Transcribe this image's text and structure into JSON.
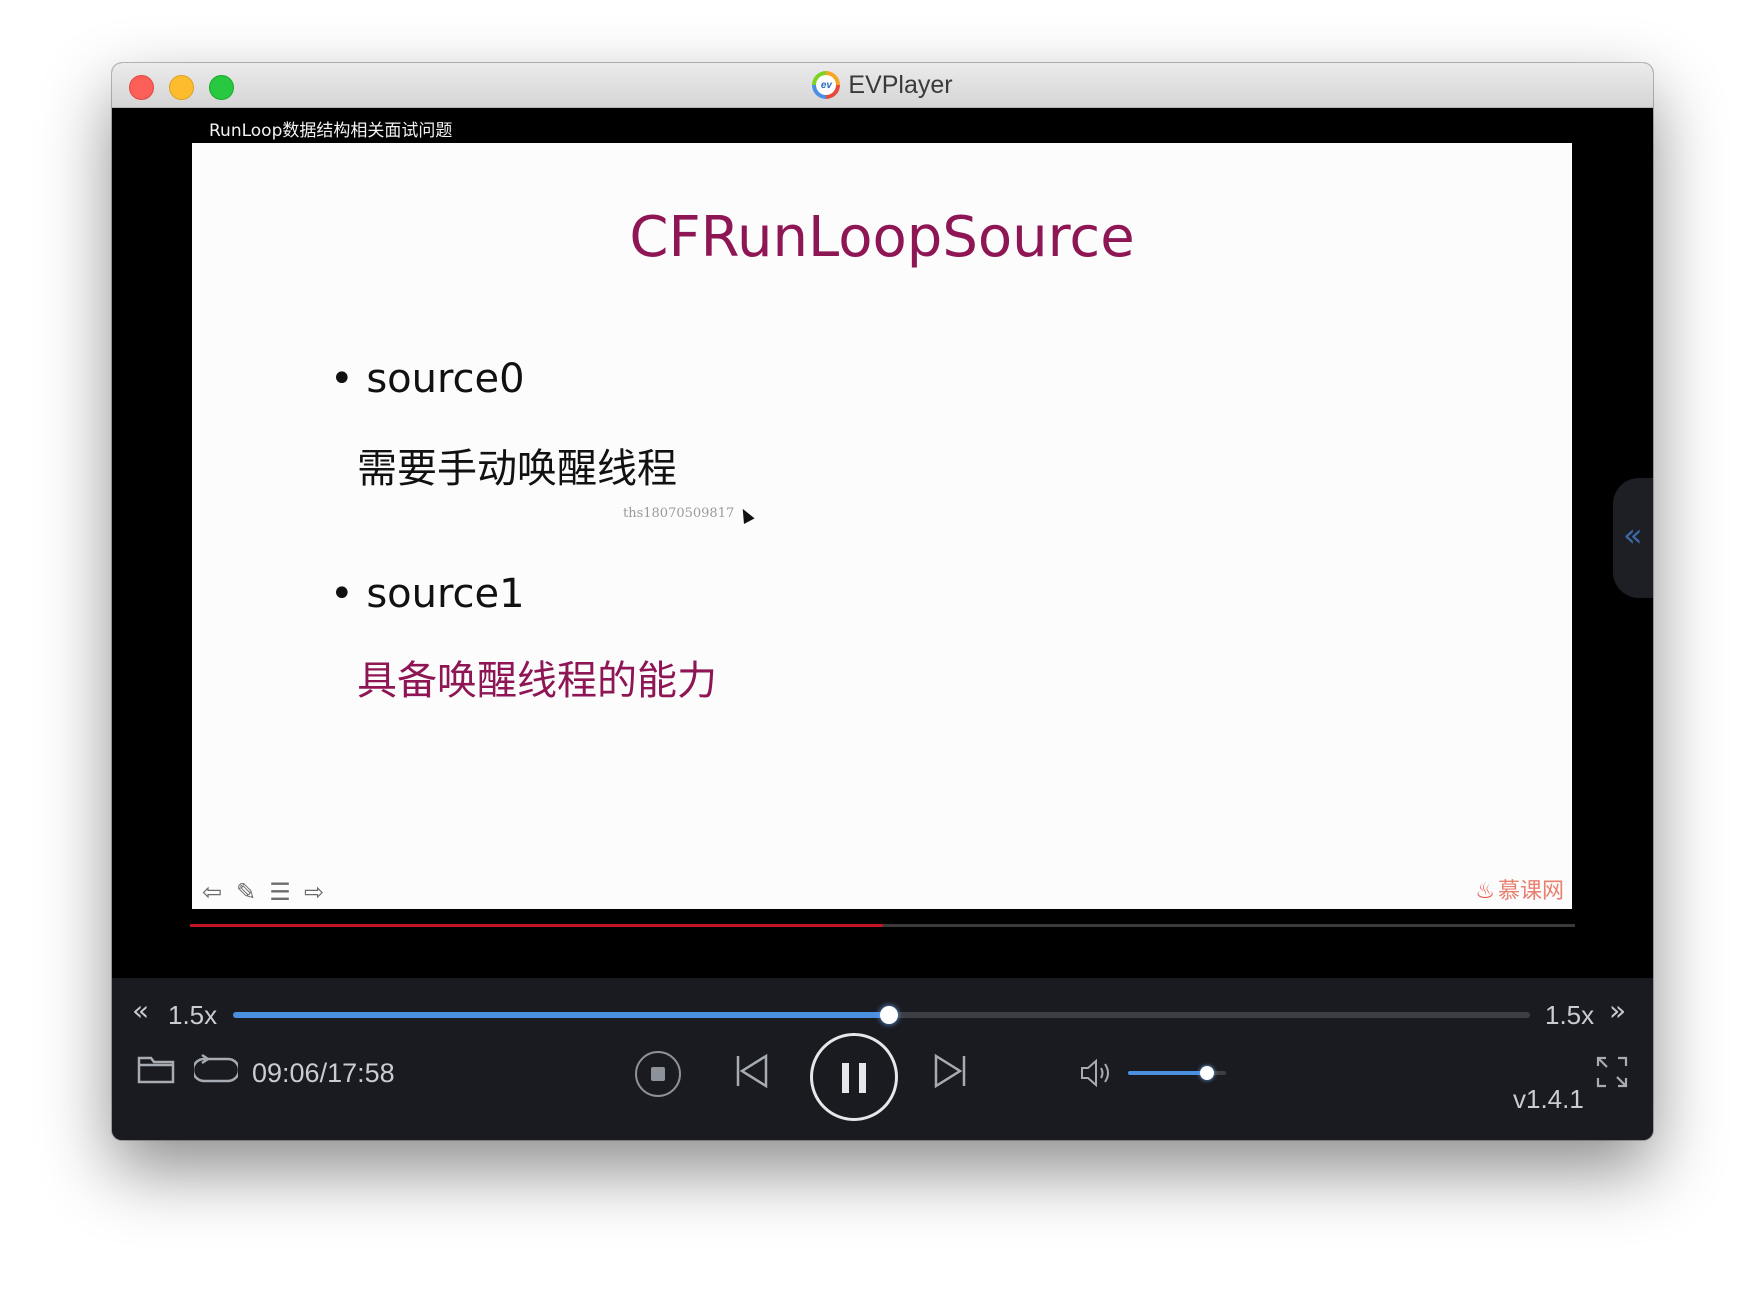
{
  "window": {
    "title": "EVPlayer"
  },
  "video": {
    "caption": "RunLoop数据结构相关面试问题",
    "progress": 0.5,
    "slide": {
      "title": "CFRunLoopSource",
      "items": [
        {
          "label": "source0",
          "description": "需要手动唤醒线程"
        },
        {
          "label": "source1",
          "description": "具备唤醒线程的能力"
        }
      ],
      "watermark": "ths18070509817",
      "brand": "慕课网"
    }
  },
  "controls": {
    "speed_left": "1.5x",
    "speed_right": "1.5x",
    "seek_progress": 0.506,
    "time": "09:06/17:58",
    "volume": 0.81,
    "version": "v1.4.1"
  },
  "colors": {
    "accent": "#4b8fe0",
    "video_progress": "#c2151f",
    "slide_title": "#8e1655"
  }
}
